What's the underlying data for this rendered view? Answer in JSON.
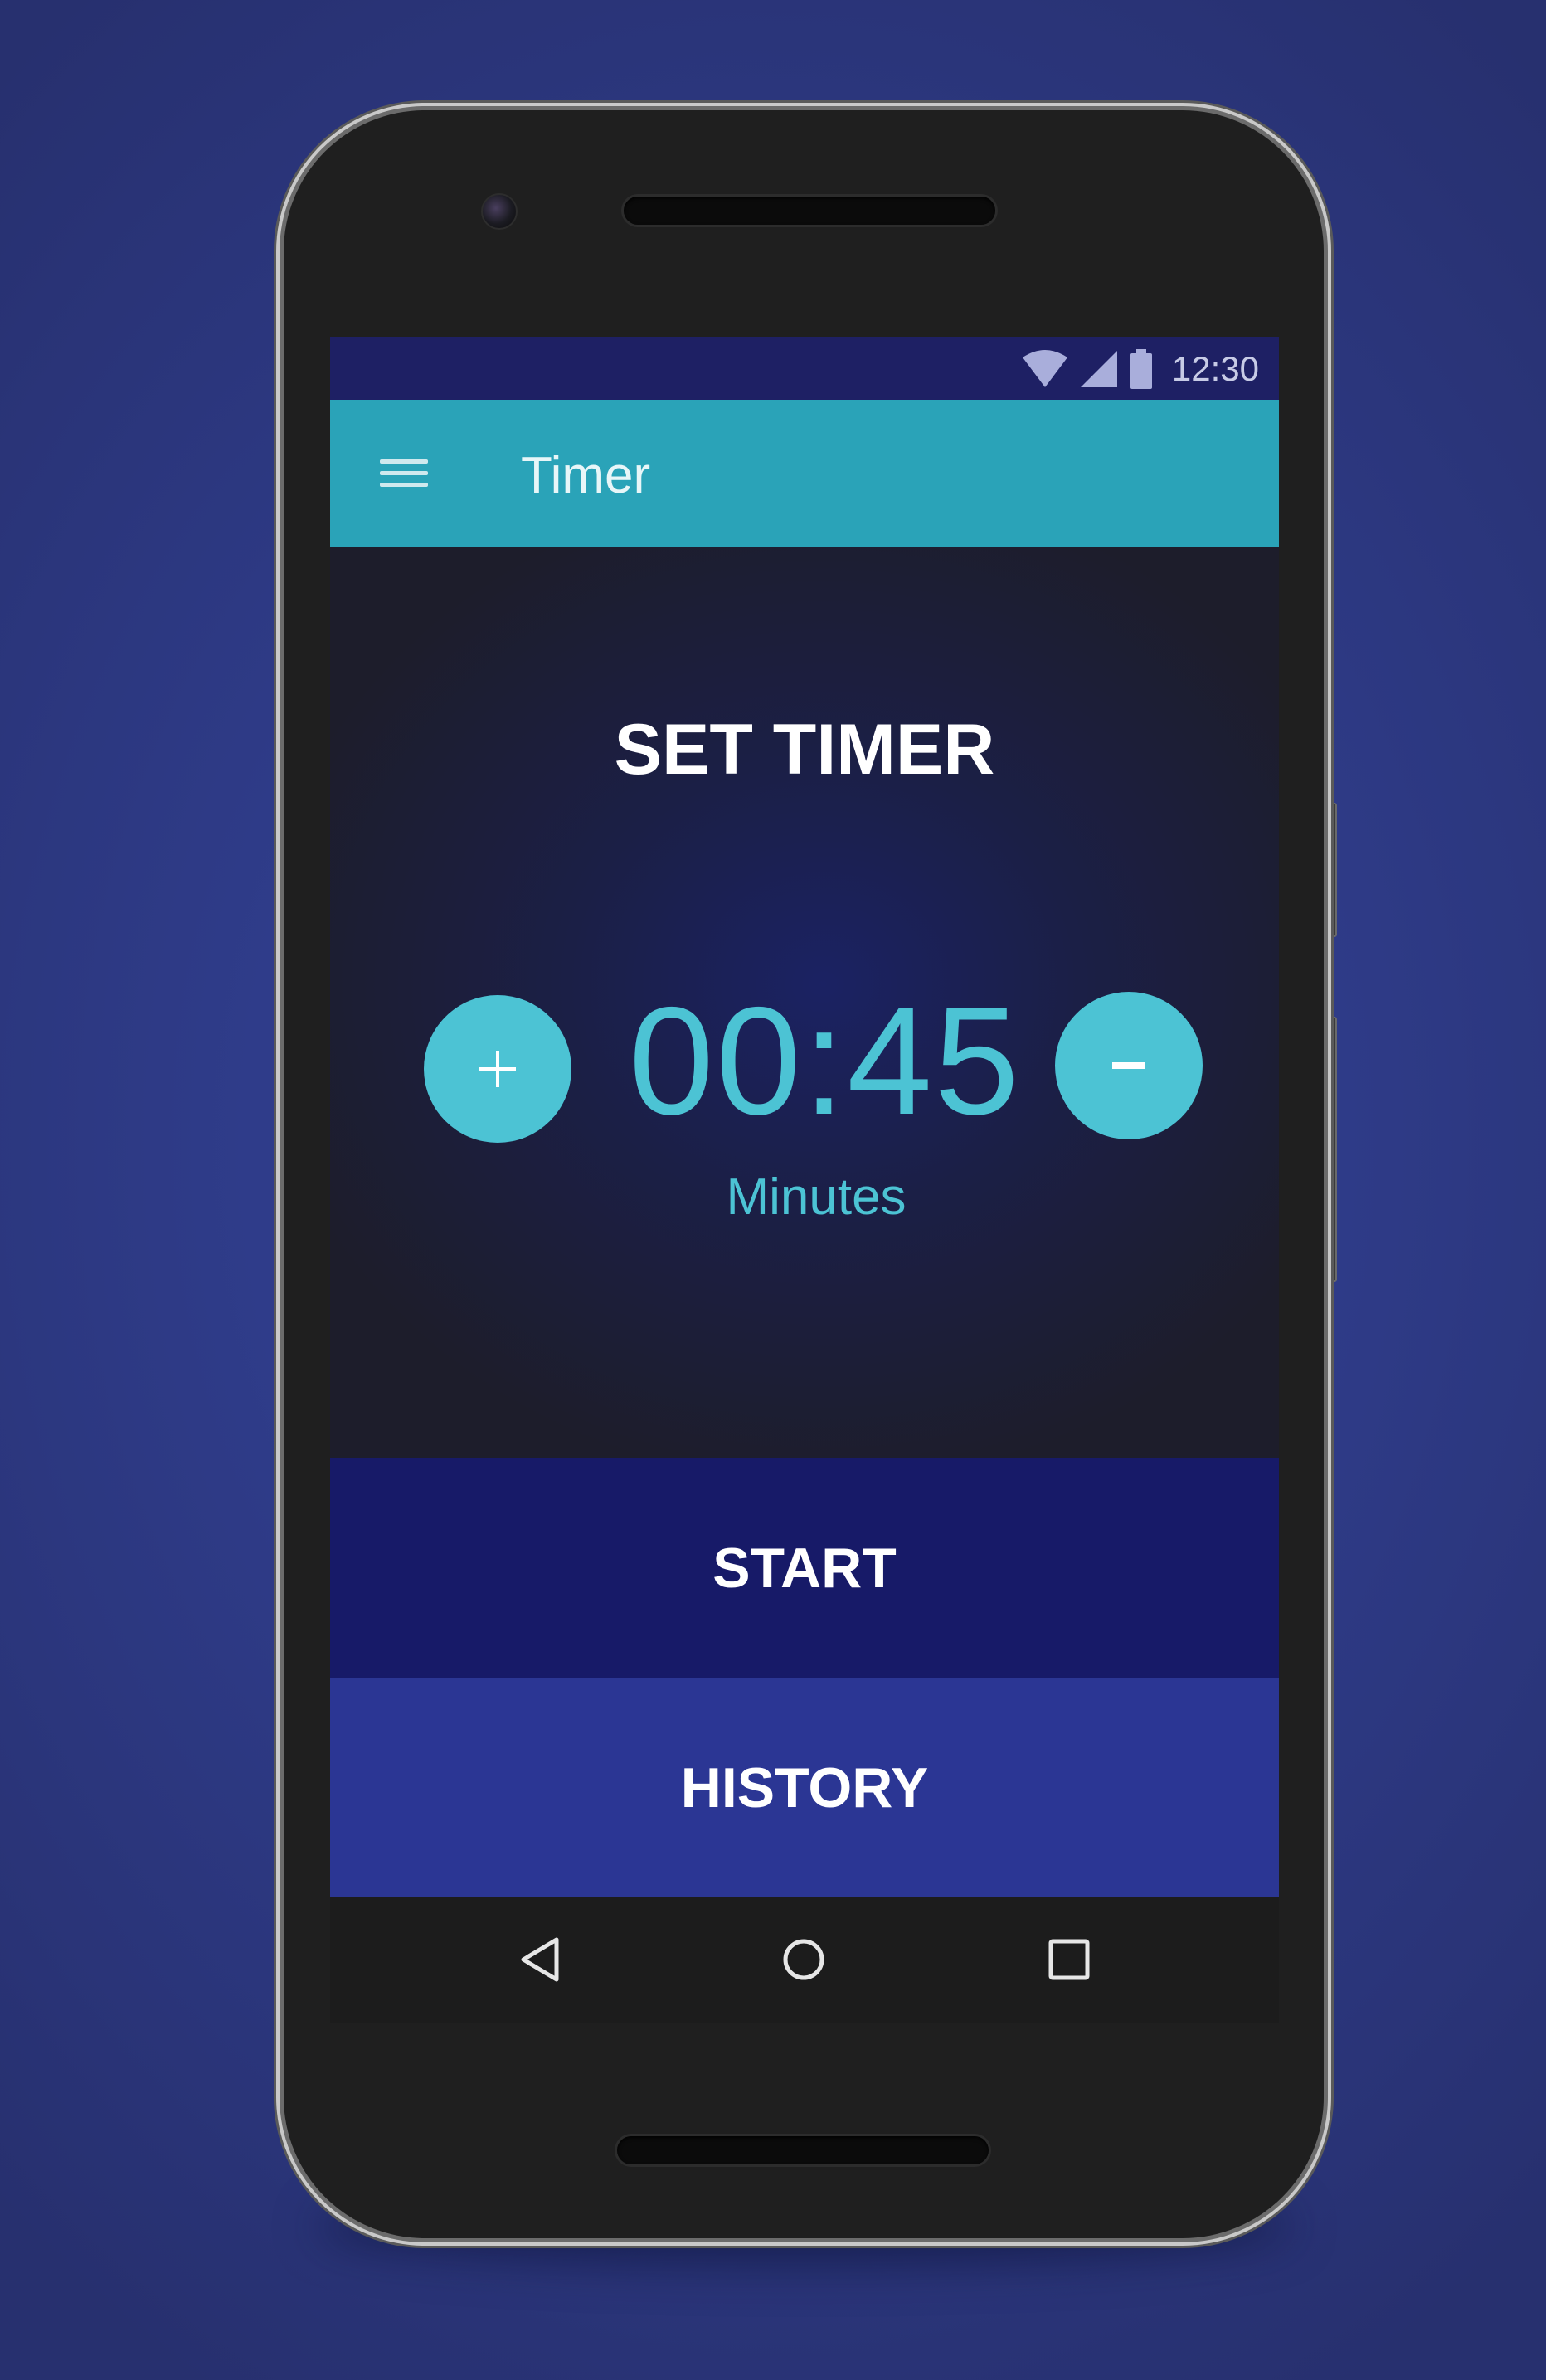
{
  "status_bar": {
    "time": "12:30",
    "icons": [
      "wifi-icon",
      "signal-icon",
      "battery-icon"
    ]
  },
  "app_bar": {
    "title": "Timer",
    "menu_icon": "hamburger-menu-icon"
  },
  "timer": {
    "heading": "SET TIMER",
    "time_value": "00:45",
    "unit_label": "Minutes",
    "increment_label": "+",
    "decrement_label": "-"
  },
  "actions": {
    "start_label": "START",
    "history_label": "HISTORY"
  },
  "nav": {
    "icons": [
      "back-triangle-icon",
      "home-circle-icon",
      "recents-square-icon"
    ]
  },
  "colors": {
    "background": "#2f3c8a",
    "status_bar": "#1e2064",
    "app_bar": "#2aa3b8",
    "accent": "#4cc3d4",
    "start_button": "#171a68",
    "history_button": "#2b3694",
    "nav_bar": "#1c1c1c"
  }
}
